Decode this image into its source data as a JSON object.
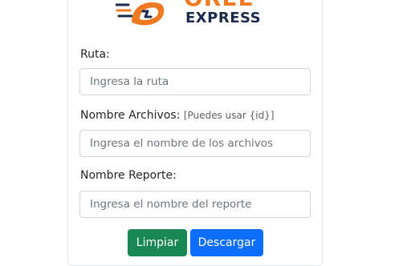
{
  "brand": {
    "line1": "OREL",
    "line2": "EXPRESS",
    "colors": {
      "orange": "#f07a22",
      "navy": "#1b2a4a"
    }
  },
  "form": {
    "ruta": {
      "label": "Ruta:",
      "placeholder": "Ingresa la ruta",
      "value": ""
    },
    "archivos": {
      "label": "Nombre Archivos:",
      "hint": "[Puedes usar {id}]",
      "placeholder": "Ingresa el nombre de los archivos",
      "value": ""
    },
    "reporte": {
      "label": "Nombre Reporte:",
      "placeholder": "Ingresa el nombre del reporte",
      "value": ""
    }
  },
  "buttons": {
    "clear_label": "Limpiar",
    "download_label": "Descargar"
  }
}
